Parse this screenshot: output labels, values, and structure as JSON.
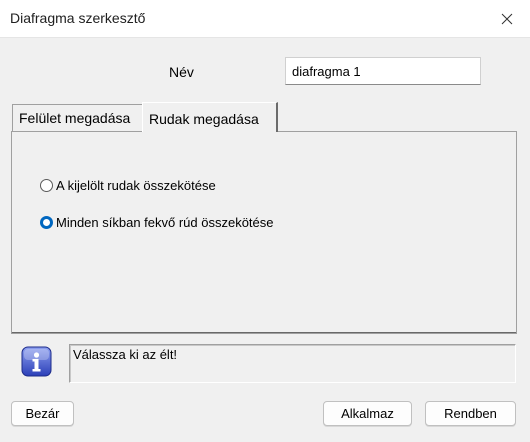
{
  "window": {
    "title": "Diafragma szerkesztő"
  },
  "form": {
    "name_label": "Név",
    "name_value": "diafragma 1"
  },
  "tabs": [
    {
      "label": "Felület megadása",
      "selected": false
    },
    {
      "label": "Rudak megadása",
      "selected": true
    }
  ],
  "options": [
    {
      "label": "A kijelölt rudak összekötése",
      "checked": false
    },
    {
      "label": "Minden síkban fekvő rúd összekötése",
      "checked": true
    }
  ],
  "status": {
    "icon": "info-icon",
    "message": "Válassza ki az élt!"
  },
  "buttons": {
    "close": "Bezár",
    "apply": "Alkalmaz",
    "ok": "Rendben"
  },
  "colors": {
    "accent": "#0067c0",
    "info_icon": "#3b4fc4"
  }
}
